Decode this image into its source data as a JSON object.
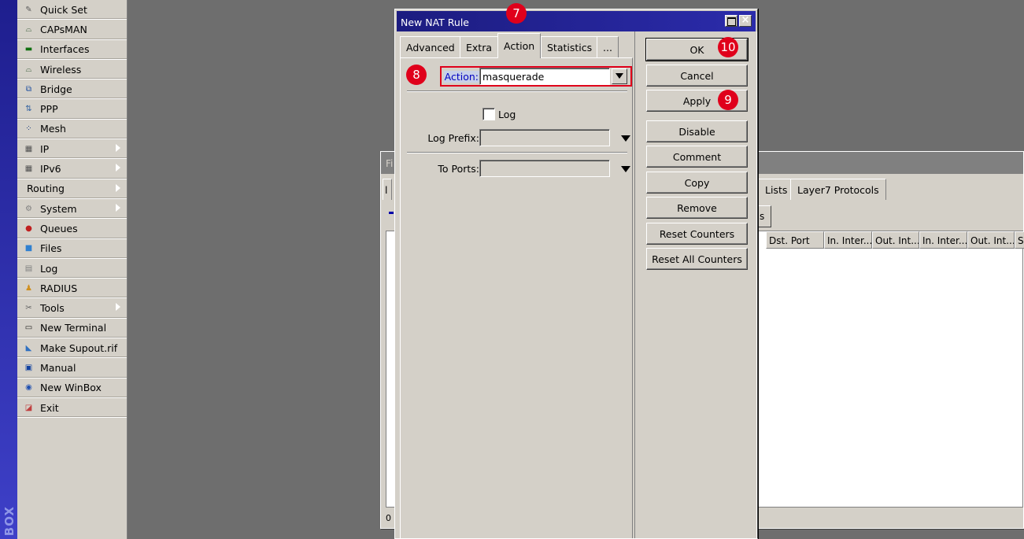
{
  "brand": "BOX",
  "sidebar": {
    "items": [
      {
        "label": "Quick Set",
        "icon": "wand-icon",
        "arrow": false
      },
      {
        "label": "CAPsMAN",
        "icon": "antenna-icon",
        "arrow": false
      },
      {
        "label": "Interfaces",
        "icon": "interfaces-icon",
        "arrow": false
      },
      {
        "label": "Wireless",
        "icon": "wireless-icon",
        "arrow": false
      },
      {
        "label": "Bridge",
        "icon": "bridge-icon",
        "arrow": false
      },
      {
        "label": "PPP",
        "icon": "ppp-icon",
        "arrow": false
      },
      {
        "label": "Mesh",
        "icon": "mesh-icon",
        "arrow": false
      },
      {
        "label": "IP",
        "icon": "ip-icon",
        "arrow": true
      },
      {
        "label": "IPv6",
        "icon": "ipv6-icon",
        "arrow": true
      },
      {
        "label": "Routing",
        "icon": "",
        "arrow": true
      },
      {
        "label": "System",
        "icon": "gear-icon",
        "arrow": true
      },
      {
        "label": "Queues",
        "icon": "queues-icon",
        "arrow": false
      },
      {
        "label": "Files",
        "icon": "folder-icon",
        "arrow": false
      },
      {
        "label": "Log",
        "icon": "log-icon",
        "arrow": false
      },
      {
        "label": "RADIUS",
        "icon": "radius-icon",
        "arrow": false
      },
      {
        "label": "Tools",
        "icon": "tools-icon",
        "arrow": true
      },
      {
        "label": "New Terminal",
        "icon": "terminal-icon",
        "arrow": false
      },
      {
        "label": "Make Supout.rif",
        "icon": "supout-icon",
        "arrow": false
      },
      {
        "label": "Manual",
        "icon": "manual-icon",
        "arrow": false
      },
      {
        "label": "New WinBox",
        "icon": "winbox-icon",
        "arrow": false
      },
      {
        "label": "Exit",
        "icon": "exit-icon",
        "arrow": false
      }
    ]
  },
  "bg_window": {
    "title": "Fi",
    "tab_partial": "Lists",
    "tab_layer7": "Layer7 Protocols",
    "toolbar_partial": "s",
    "columns": [
      "Dst. Port",
      "In. Inter...",
      "Out. Int...",
      "In. Inter...",
      "Out. Int...",
      "Sr"
    ],
    "status": "0"
  },
  "dialog": {
    "title": "New NAT Rule",
    "tabs": [
      "Advanced",
      "Extra",
      "Action",
      "Statistics",
      "..."
    ],
    "active_tab": "Action",
    "action_label": "Action:",
    "action_value": "masquerade",
    "log_label": "Log",
    "log_prefix_label": "Log Prefix:",
    "to_ports_label": "To Ports:",
    "buttons": [
      "OK",
      "Cancel",
      "Apply",
      "Disable",
      "Comment",
      "Copy",
      "Remove",
      "Reset Counters",
      "Reset All Counters"
    ]
  },
  "badges": [
    "7",
    "8",
    "9",
    "10"
  ],
  "colors": {
    "highlight": "#e0001b",
    "titlebar": "#1c1c80",
    "panel": "#d4d0c8"
  }
}
